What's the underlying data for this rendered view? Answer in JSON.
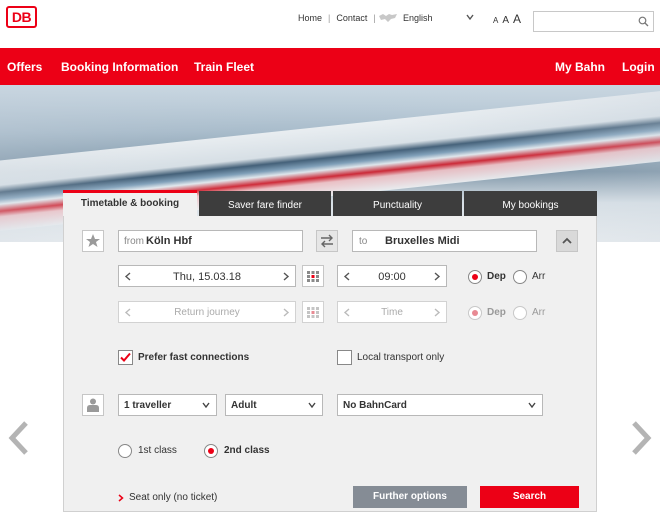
{
  "brand": {
    "logo_text": "DB",
    "accent": "#ec0016"
  },
  "toplinks": {
    "home": "Home",
    "contact": "Contact",
    "language": "English",
    "font_sizes": [
      "A",
      "A",
      "A"
    ]
  },
  "search": {
    "placeholder": ""
  },
  "nav": {
    "left": [
      "Offers",
      "Booking Information",
      "Train Fleet"
    ],
    "right": [
      "My Bahn",
      "Login"
    ]
  },
  "tabs": [
    "Timetable & booking",
    "Saver fare finder",
    "Punctuality",
    "My bookings"
  ],
  "form": {
    "from_label": "from",
    "from_value": "Köln Hbf",
    "to_label": "to",
    "to_value": "Bruxelles Midi",
    "date": "Thu, 15.03.18",
    "time": "09:00",
    "dep": "Dep",
    "arr": "Arr",
    "return_placeholder": "Return journey",
    "return_time_placeholder": "Time",
    "return_dep": "Dep",
    "return_arr": "Arr",
    "fast_connections": "Prefer fast connections",
    "local_transport": "Local transport only",
    "travellers": "1 traveller",
    "age": "Adult",
    "bahncard": "No BahnCard",
    "first_class": "1st class",
    "second_class": "2nd class",
    "seat_only": "Seat only (no ticket)",
    "further_options": "Further options",
    "search": "Search"
  }
}
